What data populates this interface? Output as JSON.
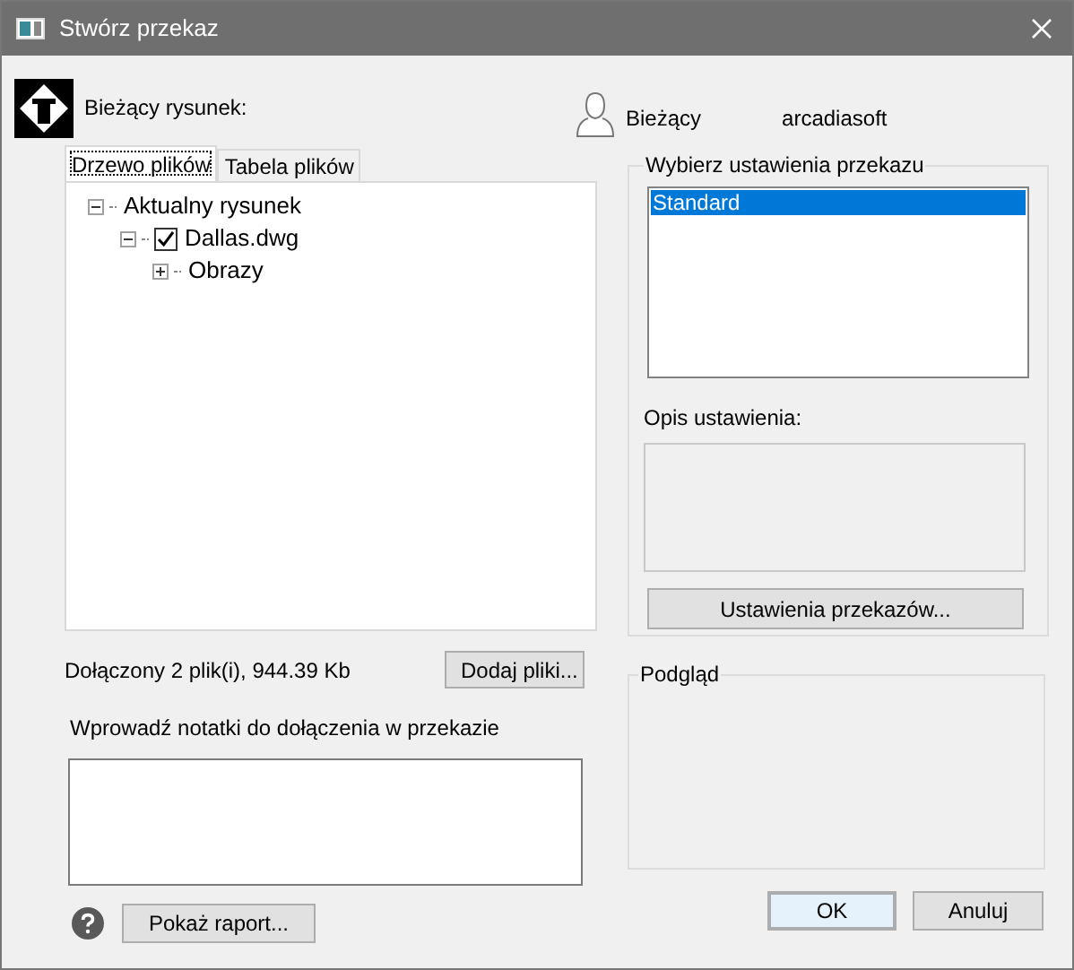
{
  "window": {
    "title": "Stwórz przekaz"
  },
  "current_drawing_label": "Bieżący rysunek:",
  "user": {
    "label": "Bieżący",
    "name": "arcadiasoft"
  },
  "tabs": [
    {
      "label": "Drzewo plików",
      "selected": true
    },
    {
      "label": "Tabela plików",
      "selected": false
    }
  ],
  "tree": [
    {
      "label": "Aktualny rysunek",
      "expanded": true,
      "children": [
        {
          "label": "Dallas.dwg",
          "checked": true,
          "expanded": true,
          "children": [
            {
              "label": "Obrazy",
              "expanded": false
            }
          ]
        }
      ]
    }
  ],
  "summary": "Dołączony 2 plik(i), 944.39 Kb",
  "add_files_button": "Dodaj pliki...",
  "notes": {
    "label": "Wprowadź notatki do dołączenia w przekazie"
  },
  "settings": {
    "title": "Wybierz ustawienia przekazu",
    "items": [
      {
        "label": "Standard",
        "selected": true
      }
    ],
    "description_label": "Opis ustawienia:",
    "button": "Ustawienia przekazów..."
  },
  "preview": {
    "title": "Podgląd"
  },
  "footer": {
    "report_button": "Pokaż raport...",
    "ok_button": "OK",
    "cancel_button": "Anuluj"
  }
}
